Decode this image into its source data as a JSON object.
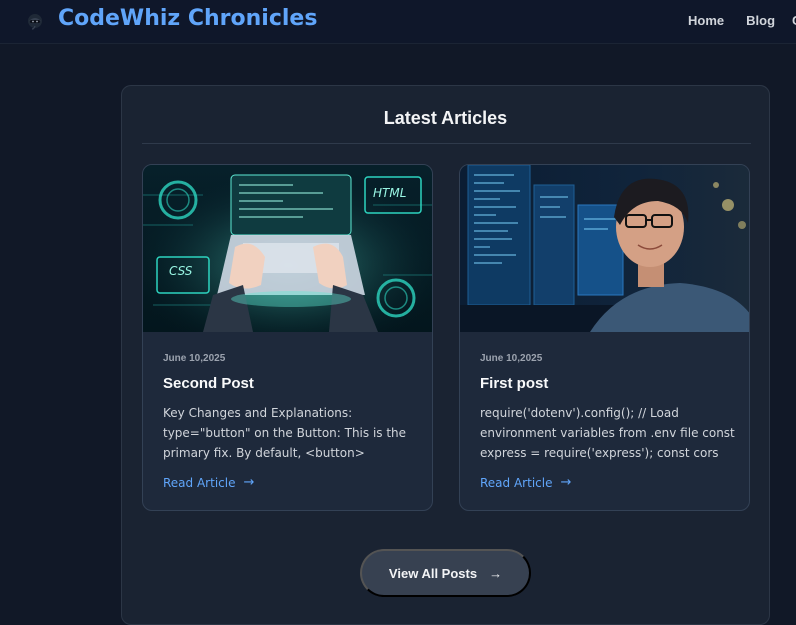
{
  "header": {
    "brand": "CodeWhiz Chronicles",
    "logo_icon": "ninja-logo-icon",
    "nav": [
      {
        "label": "Home"
      },
      {
        "label": "Blog"
      }
    ],
    "nav_overflow": "C"
  },
  "section": {
    "title": "Latest Articles",
    "view_all_label": "View All Posts",
    "view_all_icon": "arrow-right-icon"
  },
  "articles": [
    {
      "date": "June 10,2025",
      "title": "Second Post",
      "excerpt": "Key Changes and Explanations: type=\"button\" on the Button: This is the primary fix. By default, <button> elements...",
      "read_more": "Read Article",
      "image": "laptop-code-illustration"
    },
    {
      "date": "June 10,2025",
      "title": "First post",
      "excerpt": "require('dotenv').config(); // Load environment variables from .env file const express = require('express'); const cors =...",
      "read_more": "Read Article",
      "image": "developer-at-monitors-photo"
    }
  ],
  "thumb_labels": {
    "html": "HTML",
    "css": "CSS"
  },
  "colors": {
    "accent": "#60a5fa",
    "background": "#111827",
    "panel": "#1a2332",
    "card": "#1e293b"
  }
}
